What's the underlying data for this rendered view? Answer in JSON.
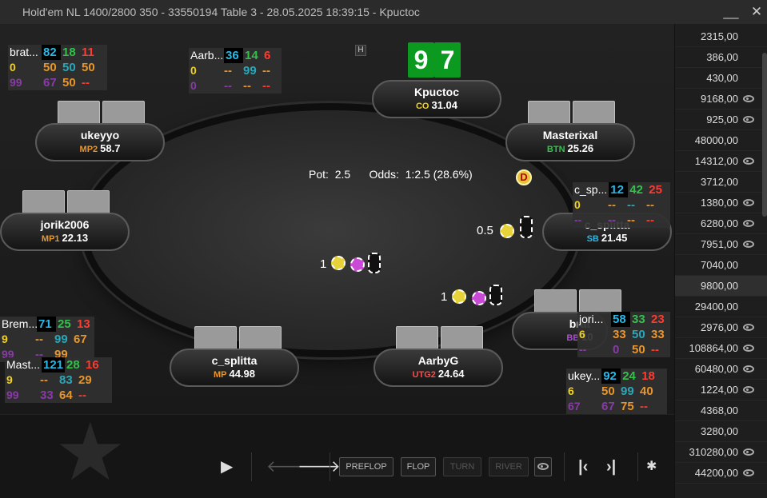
{
  "window": {
    "title": "Hold'em NL 1400/2800 350 - 33550194 Table 3 - 28.05.2025 18:39:15 - Kpuctoc",
    "minimize": "__",
    "close": "✕"
  },
  "colors": {
    "cyan": "#29b8e8",
    "green": "#32c24a",
    "red": "#ff3b30",
    "yellow": "#f2d21a",
    "orange": "#e8962a",
    "teal": "#2aa7b8",
    "purple": "#8a3aa8",
    "white": "#ffffff",
    "gray": "#b0b0b0"
  },
  "hero_cards": [
    "9",
    "7"
  ],
  "pot": {
    "label": "Pot:",
    "value": "2.5",
    "odds_label": "Odds:",
    "odds_value": "1:2.5 (28.6%)"
  },
  "dealer_button": "D",
  "seats": [
    {
      "name": "Kpuctoc",
      "pos": "CO",
      "pos_color": "#f2d21a",
      "stack": "31.04"
    },
    {
      "name": "Masterixal",
      "pos": "BTN",
      "pos_color": "#32c24a",
      "stack": "25.26"
    },
    {
      "name": "c_splitta",
      "pos": "SB",
      "pos_color": "#29b8e8",
      "stack": "21.45"
    },
    {
      "name": "brat",
      "pos": "BB",
      "pos_color": "#b04ad8",
      "stack": "10"
    },
    {
      "name": "AarbyG",
      "pos": "UTG2",
      "pos_color": "#ff4a4a",
      "stack": "24.64"
    },
    {
      "name": "c_splitta",
      "pos": "MP",
      "pos_color": "#e8962a",
      "stack": "44.98"
    },
    {
      "name": "jorik2006",
      "pos": "MP1",
      "pos_color": "#e8962a",
      "stack": "22.13"
    },
    {
      "name": "ukeyyo",
      "pos": "MP2",
      "pos_color": "#e8962a",
      "stack": "58.7"
    }
  ],
  "bets": [
    {
      "amount": "0.5"
    },
    {
      "amount": "1"
    },
    {
      "amount": "1"
    }
  ],
  "huds": [
    {
      "rows": [
        [
          {
            "t": "brat...",
            "c": "white"
          },
          {
            "t": "82",
            "c": "cyan"
          },
          {
            "t": "18",
            "c": "green"
          },
          {
            "t": "11",
            "c": "red"
          }
        ],
        [
          {
            "t": "0",
            "c": "yellow"
          },
          {
            "t": "50",
            "c": "orange"
          },
          {
            "t": "50",
            "c": "teal"
          },
          {
            "t": "50",
            "c": "orange"
          }
        ],
        [
          {
            "t": "99",
            "c": "purple"
          },
          {
            "t": "67",
            "c": "purple"
          },
          {
            "t": "50",
            "c": "orange"
          },
          {
            "t": "--",
            "c": "red"
          }
        ]
      ]
    },
    {
      "rows": [
        [
          {
            "t": "Aarb...",
            "c": "white"
          },
          {
            "t": "36",
            "c": "cyan"
          },
          {
            "t": "14",
            "c": "green"
          },
          {
            "t": "6",
            "c": "red"
          }
        ],
        [
          {
            "t": "0",
            "c": "yellow"
          },
          {
            "t": "--",
            "c": "orange"
          },
          {
            "t": "99",
            "c": "teal"
          },
          {
            "t": "--",
            "c": "orange"
          }
        ],
        [
          {
            "t": "0",
            "c": "purple"
          },
          {
            "t": "--",
            "c": "purple"
          },
          {
            "t": "--",
            "c": "orange"
          },
          {
            "t": "--",
            "c": "red"
          }
        ]
      ]
    },
    {
      "rows": [
        [
          {
            "t": "c_sp...",
            "c": "white"
          },
          {
            "t": "12",
            "c": "cyan"
          },
          {
            "t": "42",
            "c": "green"
          },
          {
            "t": "25",
            "c": "red"
          }
        ],
        [
          {
            "t": "0",
            "c": "yellow"
          },
          {
            "t": "--",
            "c": "orange"
          },
          {
            "t": "--",
            "c": "teal"
          },
          {
            "t": "--",
            "c": "orange"
          }
        ],
        [
          {
            "t": "--",
            "c": "purple"
          },
          {
            "t": "--",
            "c": "purple"
          },
          {
            "t": "--",
            "c": "orange"
          },
          {
            "t": "--",
            "c": "red"
          }
        ]
      ]
    },
    {
      "rows": [
        [
          {
            "t": "jori...",
            "c": "white"
          },
          {
            "t": "58",
            "c": "cyan"
          },
          {
            "t": "33",
            "c": "green"
          },
          {
            "t": "23",
            "c": "red"
          }
        ],
        [
          {
            "t": "6",
            "c": "yellow"
          },
          {
            "t": "33",
            "c": "orange"
          },
          {
            "t": "50",
            "c": "teal"
          },
          {
            "t": "33",
            "c": "orange"
          }
        ],
        [
          {
            "t": "--",
            "c": "purple"
          },
          {
            "t": "0",
            "c": "purple"
          },
          {
            "t": "50",
            "c": "orange"
          },
          {
            "t": "--",
            "c": "red"
          }
        ]
      ]
    },
    {
      "rows": [
        [
          {
            "t": "ukey...",
            "c": "white"
          },
          {
            "t": "92",
            "c": "cyan"
          },
          {
            "t": "24",
            "c": "green"
          },
          {
            "t": "18",
            "c": "red"
          }
        ],
        [
          {
            "t": "6",
            "c": "yellow"
          },
          {
            "t": "50",
            "c": "orange"
          },
          {
            "t": "99",
            "c": "teal"
          },
          {
            "t": "40",
            "c": "orange"
          }
        ],
        [
          {
            "t": "67",
            "c": "purple"
          },
          {
            "t": "67",
            "c": "purple"
          },
          {
            "t": "75",
            "c": "orange"
          },
          {
            "t": "--",
            "c": "red"
          }
        ]
      ]
    },
    {
      "rows": [
        [
          {
            "t": "Brem...",
            "c": "white"
          },
          {
            "t": "71",
            "c": "cyan"
          },
          {
            "t": "25",
            "c": "green"
          },
          {
            "t": "13",
            "c": "red"
          }
        ],
        [
          {
            "t": "9",
            "c": "yellow"
          },
          {
            "t": "--",
            "c": "orange"
          },
          {
            "t": "99",
            "c": "teal"
          },
          {
            "t": "67",
            "c": "orange"
          }
        ],
        [
          {
            "t": "99",
            "c": "purple"
          },
          {
            "t": "--",
            "c": "purple"
          },
          {
            "t": "99",
            "c": "orange"
          },
          {
            "t": "",
            "c": "red"
          }
        ]
      ]
    },
    {
      "rows": [
        [
          {
            "t": "Mast...",
            "c": "white"
          },
          {
            "t": "121",
            "c": "cyan"
          },
          {
            "t": "28",
            "c": "green"
          },
          {
            "t": "16",
            "c": "red"
          }
        ],
        [
          {
            "t": "9",
            "c": "yellow"
          },
          {
            "t": "--",
            "c": "orange"
          },
          {
            "t": "83",
            "c": "teal"
          },
          {
            "t": "29",
            "c": "orange"
          }
        ],
        [
          {
            "t": "99",
            "c": "purple"
          },
          {
            "t": "33",
            "c": "purple"
          },
          {
            "t": "64",
            "c": "orange"
          },
          {
            "t": "--",
            "c": "red"
          }
        ]
      ]
    }
  ],
  "history": [
    {
      "v": "2315,00",
      "eye": false
    },
    {
      "v": "386,00",
      "eye": false
    },
    {
      "v": "430,00",
      "eye": false
    },
    {
      "v": "9168,00",
      "eye": true
    },
    {
      "v": "925,00",
      "eye": true
    },
    {
      "v": "48000,00",
      "eye": false
    },
    {
      "v": "14312,00",
      "eye": true
    },
    {
      "v": "3712,00",
      "eye": false
    },
    {
      "v": "1380,00",
      "eye": true
    },
    {
      "v": "6280,00",
      "eye": true
    },
    {
      "v": "7951,00",
      "eye": true
    },
    {
      "v": "7040,00",
      "eye": false
    },
    {
      "v": "9800,00",
      "eye": false,
      "sel": true
    },
    {
      "v": "29400,00",
      "eye": false
    },
    {
      "v": "2976,00",
      "eye": true
    },
    {
      "v": "108864,00",
      "eye": true
    },
    {
      "v": "60480,00",
      "eye": true
    },
    {
      "v": "1224,00",
      "eye": true
    },
    {
      "v": "4368,00",
      "eye": false
    },
    {
      "v": "3280,00",
      "eye": false
    },
    {
      "v": "310280,00",
      "eye": true
    },
    {
      "v": "44200,00",
      "eye": true
    }
  ],
  "controls": {
    "preflop": "PREFLOP",
    "flop": "FLOP",
    "turn": "TURN",
    "river": "RIVER",
    "play": "▶",
    "prev": "🡐",
    "next": "🡒",
    "first": "|‹",
    "last": "›|",
    "settings": "✱"
  }
}
